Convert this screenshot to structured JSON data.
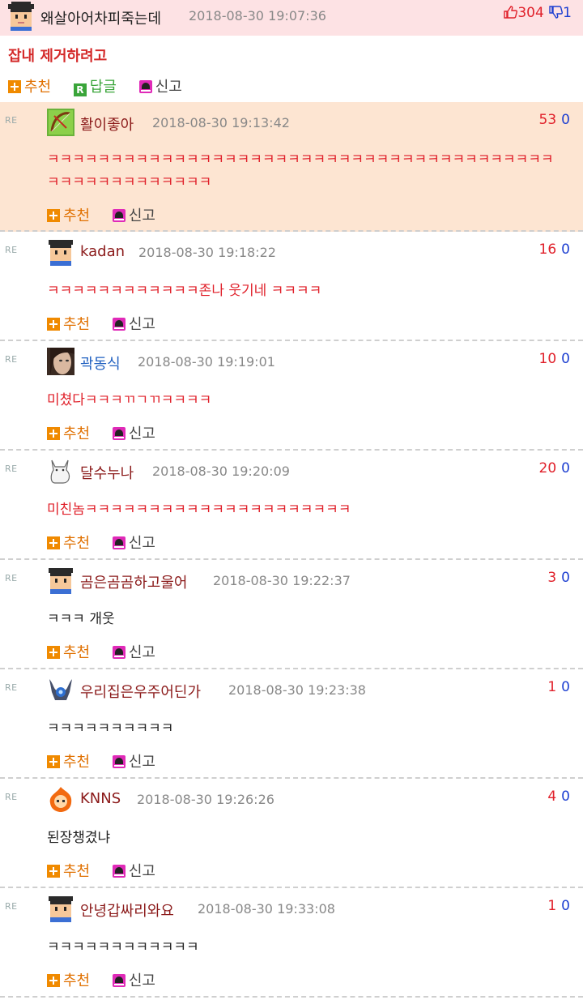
{
  "post": {
    "author": "왜살아어차피죽는데",
    "timestamp": "2018-08-30 19:07:36",
    "upvotes": "304",
    "downvotes": "1",
    "title": "잡내 제거하려고",
    "actions": {
      "recommend": "추천",
      "reply": "답글",
      "report": "신고"
    }
  },
  "comment_labels": {
    "re": "RE",
    "recommend": "추천",
    "report": "신고"
  },
  "comments": [
    {
      "author": "활이좋아",
      "timestamp": "2018-08-30 19:13:42",
      "up": "53",
      "down": "0",
      "text": "ㅋㅋㅋㅋㅋㅋㅋㅋㅋㅋㅋㅋㅋㅋㅋㅋㅋㅋㅋㅋㅋㅋㅋㅋㅋㅋㅋㅋㅋㅋㅋㅋㅋㅋㅋㅋㅋㅋㅋㅋㅋㅋㅋㅋㅋㅋㅋㅋㅋㅋㅋㅋㅋ",
      "highlight": true,
      "avatar_icon": "bow-avatar"
    },
    {
      "author": "kadan",
      "timestamp": "2018-08-30 19:18:22",
      "up": "16",
      "down": "0",
      "text": "ㅋㅋㅋㅋㅋㅋㅋㅋㅋㅋㅋㅋ존나 웃기네 ㅋㅋㅋㅋ",
      "avatar_icon": "default-avatar"
    },
    {
      "author": "곽동식",
      "timestamp": "2018-08-30 19:19:01",
      "up": "10",
      "down": "0",
      "text": "미쳤다ㅋㅋㅋㄲㄱㄲㅋㅋㅋㅋ",
      "avatar_icon": "photo-avatar"
    },
    {
      "author": "달수누나",
      "timestamp": "2018-08-30 19:20:09",
      "up": "20",
      "down": "0",
      "text": "미친놈ㅋㅋㅋㅋㅋㅋㅋㅋㅋㅋㅋㅋㅋㅋㅋㅋㅋㅋㅋㅋㅋ",
      "avatar_icon": "cat-avatar"
    },
    {
      "author": "곰은곰곰하고울어",
      "timestamp": "2018-08-30 19:22:37",
      "up": "3",
      "down": "0",
      "text": "ㅋㅋㅋ 개웃",
      "avatar_icon": "default-avatar"
    },
    {
      "author": "우리집은우주어딘가",
      "timestamp": "2018-08-30 19:23:38",
      "up": "1",
      "down": "0",
      "text": "ㅋㅋㅋㅋㅋㅋㅋㅋㅋㅋ",
      "avatar_icon": "armor-avatar"
    },
    {
      "author": "KNNS",
      "timestamp": "2018-08-30 19:26:26",
      "up": "4",
      "down": "0",
      "text": "된장챙겼냐",
      "avatar_icon": "fire-avatar"
    },
    {
      "author": "안녕갑싸리와요",
      "timestamp": "2018-08-30 19:33:08",
      "up": "1",
      "down": "0",
      "text": "ㅋㅋㅋㅋㅋㅋㅋㅋㅋㅋㅋㅋ",
      "avatar_icon": "default-avatar"
    }
  ],
  "colors": {
    "post_header_bg": "#fde2e4",
    "highlight_bg": "#fde5d2",
    "upvote": "#e0202a",
    "downvote": "#1d3fd1",
    "comment_text": "#e0202a"
  }
}
